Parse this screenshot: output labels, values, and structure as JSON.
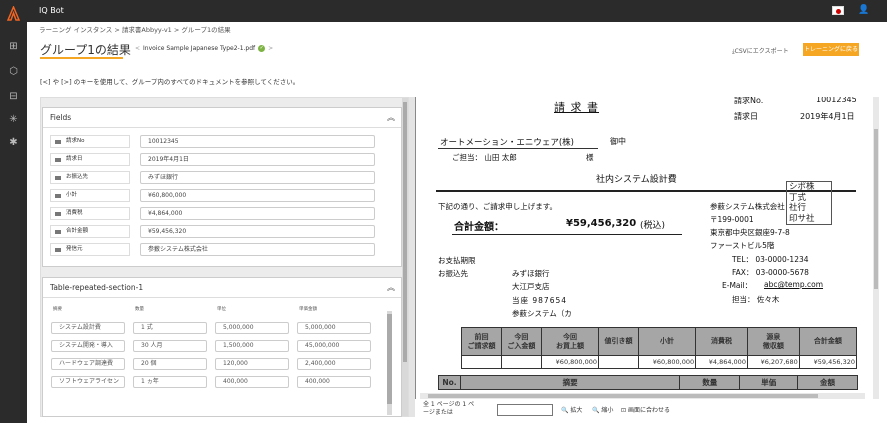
{
  "app": {
    "title": "IQ Bot"
  },
  "breadcrumb": "ラーニング インスタンス > 請求書Abbyy-v1 > グループ1の結果",
  "page": {
    "title": "グループ1の結果",
    "doc_name": "Invoice Sample Japanese Type2-1.pdf",
    "prev": "<",
    "next": ">",
    "csv_export": "CSVにエクスポート",
    "train_button": "トレーニングに戻る",
    "hint": "[<] や [>] のキーを使用して、グループ内のすべてのドキュメントを参照してください。"
  },
  "fields_panel": {
    "title": "Fields",
    "rows": [
      {
        "label": "請求No",
        "value": "10012345"
      },
      {
        "label": "請求日",
        "value": "2019年4月1日"
      },
      {
        "label": "お振込先",
        "value": "みずほ銀行"
      },
      {
        "label": "小計",
        "value": "¥60,800,000"
      },
      {
        "label": "消費税",
        "value": "¥4,864,000"
      },
      {
        "label": "合計金額",
        "value": "¥59,456,320"
      },
      {
        "label": "発信元",
        "value": "参薮システム株式会社"
      }
    ]
  },
  "table_panel": {
    "title": "Table-repeated-section-1",
    "columns": [
      "摘要",
      "数量",
      "単位",
      "単価金額"
    ],
    "rows": [
      [
        "システム設計費",
        "1 式",
        "5,000,000",
        "5,000,000"
      ],
      [
        "システム開発・導入",
        "30 人月",
        "1,500,000",
        "45,000,000"
      ],
      [
        "ハードウェア調達費",
        "20 個",
        "120,000",
        "2,400,000"
      ],
      [
        "ソフトウェアライセン",
        "1 ヵ年",
        "400,000",
        "400,000"
      ]
    ]
  },
  "document": {
    "title": "請 求 書",
    "invoice_no_label": "請求No.",
    "invoice_no": "10012345",
    "date_label": "請求日",
    "date": "2019年4月1日",
    "customer": "オートメーション・エニウェア(株)",
    "onchu": "御中",
    "contact": "ご担当：  山田   太郎",
    "sama": "様",
    "subject": "社内システム設計費",
    "intro": "下記の通り、ご請求申し上げます。",
    "total_label": "合計金額：",
    "total_value": "¥59,456,320",
    "tax_incl": "(税込)",
    "sender": "参薮システム株式会社",
    "zip": "〒199-0001",
    "addr": "東京都中央区銀座9-7-8",
    "bldg": "ファーストビル5階",
    "tel": "TEL： 03-0000-1234",
    "fax": "FAX： 03-0000-5678",
    "email_label": "E-Mail：",
    "email": "abc@temp.com",
    "tanto": "担当：  佐々木",
    "seal": "シポ株\n丁式\n社行\n印サ社",
    "due_label": "お支払期限",
    "pay_label": "お振込先",
    "bank": "みずほ銀行",
    "branch": "大江戸支店",
    "acct": "当座  987654",
    "holder": "参薮システム（カ",
    "sum_table": {
      "headers": [
        [
          "前回",
          "ご請求額"
        ],
        [
          "今回",
          "ご入金額"
        ],
        [
          "今回",
          "お買上額"
        ],
        [
          "値引き額"
        ],
        [
          "小計"
        ],
        [
          "消費税"
        ],
        [
          "源泉",
          "徴収額"
        ],
        [
          "合計金額"
        ]
      ],
      "values": [
        "",
        "",
        "¥60,800,000",
        "",
        "¥60,800,000",
        "¥4,864,000",
        "¥6,207,680",
        "¥59,456,320"
      ]
    },
    "item_headers": [
      "No.",
      "摘要",
      "数量",
      "単価",
      "金額"
    ]
  },
  "footer": {
    "page_info": "全 1 ページの 1 ペ\nージまたは",
    "zoom_in": "拡大",
    "zoom_out": "縮小",
    "fit": "画面に合わせる"
  }
}
